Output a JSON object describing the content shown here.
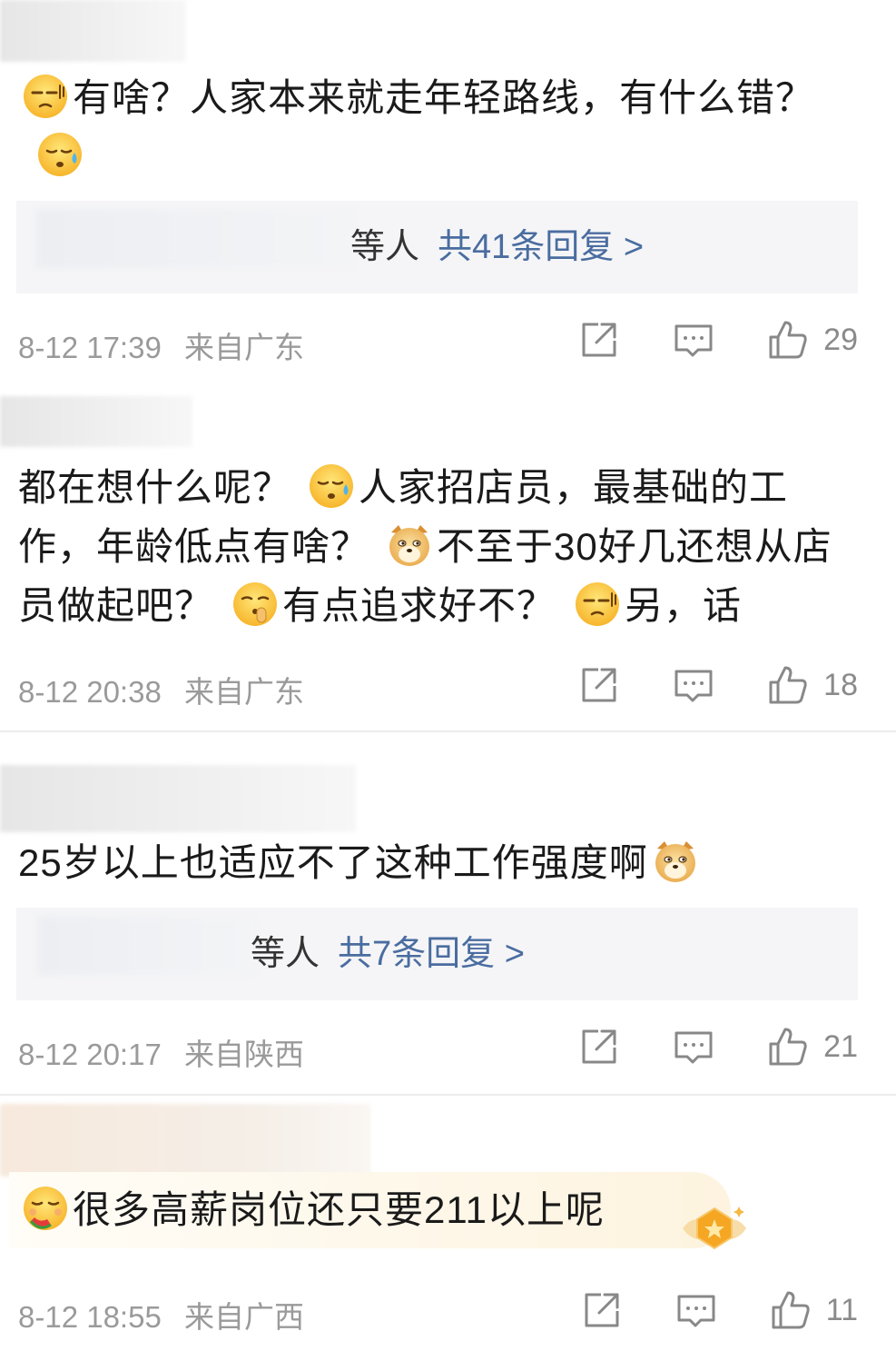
{
  "comments": [
    {
      "text_1": "有啥？人家本来就走年轻路线，有什么错？",
      "replies": {
        "suffix": "等人",
        "link": "共41条回复 >"
      },
      "time": "8-12 17:39",
      "location": "来自广东",
      "likes": "29"
    },
    {
      "text_1": "都在想什么呢？",
      "text_2": "人家招店员，最基础的工作，年龄低点有啥？",
      "text_3": "不至于30好几还想从店员做起吧？",
      "text_4": "有点追求好不？",
      "text_5": "另，话",
      "time": "8-12 20:38",
      "location": "来自广东",
      "likes": "18"
    },
    {
      "text_1": "25岁以上也适应不了这种工作强度啊",
      "replies": {
        "suffix": "等人",
        "link": "共7条回复 >"
      },
      "time": "8-12 20:17",
      "location": "来自陕西",
      "likes": "21"
    },
    {
      "text_1": "很多高薪岗位还只要211以上呢",
      "time": "8-12 18:55",
      "location": "来自广西",
      "likes": "11"
    }
  ],
  "icons": {
    "share": "share-icon",
    "comment": "comment-icon",
    "like": "thumbs-up-icon"
  },
  "colors": {
    "link": "#4a6da0",
    "meta": "#9a9a9a",
    "reply_bg": "#f5f5f7"
  }
}
